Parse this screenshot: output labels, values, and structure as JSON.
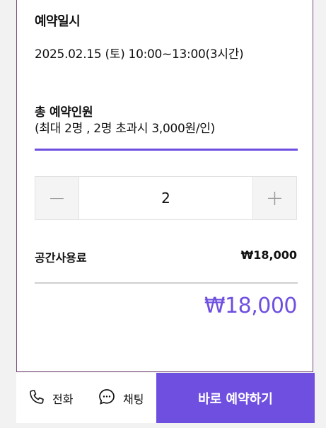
{
  "reservation": {
    "date_label": "예약일시",
    "date_value": "2025.02.15 (토) 10:00~13:00(3시간)",
    "people_label": "총 예약인원",
    "people_note": "(최대 2명 , 2명 초과시 3,000원/인)"
  },
  "stepper": {
    "minus": "−",
    "value": "2",
    "plus": "+"
  },
  "pricing": {
    "fee_label": "공간사용료",
    "fee_value": "₩18,000",
    "total": "₩18,000"
  },
  "bottom_bar": {
    "call_label": "전화",
    "chat_label": "채팅",
    "reserve_label": "바로 예약하기"
  },
  "colors": {
    "accent": "#6f4fe0",
    "divider": "#cfcfcf"
  },
  "icons": [
    "phone-icon",
    "chat-bubble-icon"
  ]
}
